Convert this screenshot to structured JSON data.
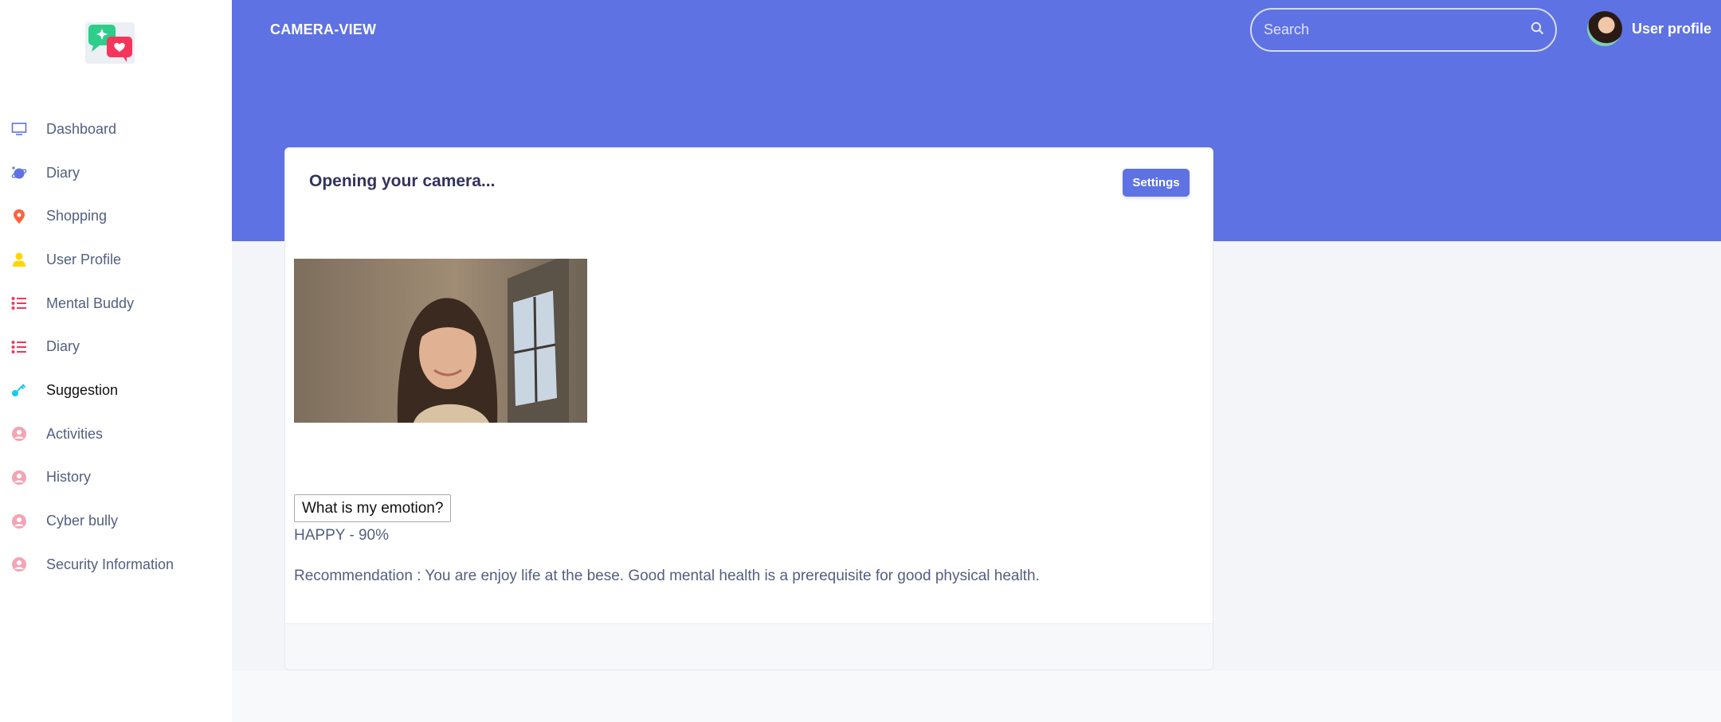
{
  "header": {
    "brand": "CAMERA-VIEW",
    "search_placeholder": "Search",
    "profile_name": "User profile"
  },
  "sidebar": {
    "items": [
      {
        "label": "Dashboard",
        "icon": "monitor-icon",
        "color": "#5e72e4"
      },
      {
        "label": "Diary",
        "icon": "planet-icon",
        "color": "#5e72e4"
      },
      {
        "label": "Shopping",
        "icon": "pin-icon",
        "color": "#fb6340"
      },
      {
        "label": "User Profile",
        "icon": "user-icon",
        "color": "#ffd600"
      },
      {
        "label": "Mental Buddy",
        "icon": "list-icon",
        "color": "#f5365c"
      },
      {
        "label": "Diary",
        "icon": "list-icon",
        "color": "#f5365c"
      },
      {
        "label": "Suggestion",
        "icon": "key-icon",
        "color": "#11cdef",
        "active": true
      },
      {
        "label": "Activities",
        "icon": "circle-user-icon",
        "color": "#f3a4b5"
      },
      {
        "label": "History",
        "icon": "circle-user-icon",
        "color": "#f3a4b5"
      },
      {
        "label": "Cyber bully",
        "icon": "circle-user-icon",
        "color": "#f3a4b5"
      },
      {
        "label": "Security Information",
        "icon": "circle-user-icon",
        "color": "#f3a4b5"
      }
    ]
  },
  "card": {
    "title": "Opening your camera...",
    "settings_label": "Settings",
    "emotion_button": "What is my emotion?",
    "result": "HAPPY - 90%",
    "recommendation": "Recommendation : You are enjoy life at the bese. Good mental health is a prerequisite for good physical health."
  },
  "colors": {
    "primary": "#5e72e4",
    "text": "#525f7f",
    "heading": "#32325d"
  }
}
